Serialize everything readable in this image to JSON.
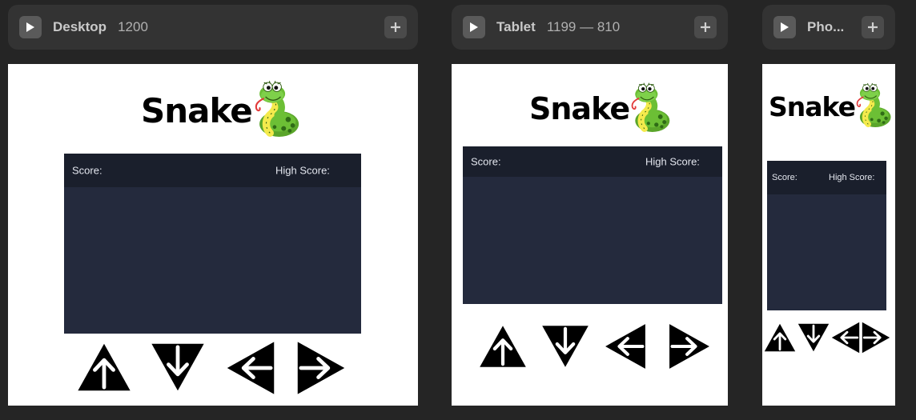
{
  "frames": [
    {
      "name": "Desktop",
      "size": "1200"
    },
    {
      "name": "Tablet",
      "size": "1199 — 810"
    },
    {
      "name": "Pho..."
    }
  ],
  "app": {
    "title": "Snake",
    "score_label": "Score:",
    "high_score_label": "High Score:"
  },
  "colors": {
    "canvas_bg": "#252525",
    "header_bg": "#333333",
    "board": "#242a3d",
    "board_header": "#1a1f2c"
  },
  "icons": [
    "play-icon",
    "plus-icon",
    "snake-icon",
    "arrow-up-icon",
    "arrow-down-icon",
    "arrow-left-icon",
    "arrow-right-icon"
  ]
}
